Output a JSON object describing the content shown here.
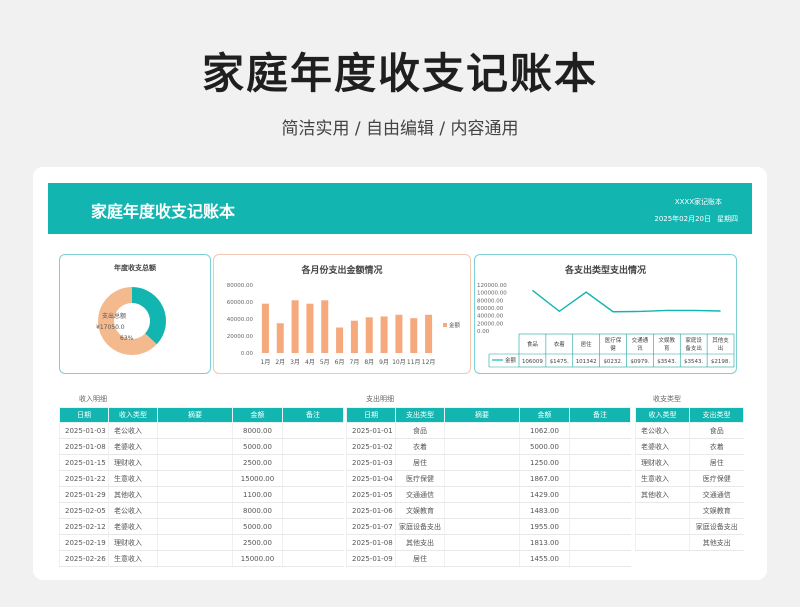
{
  "hero": {
    "title": "家庭年度收支记账本",
    "subtitle": "简洁实用 / 自由编辑 / 内容通用"
  },
  "banner": {
    "title": "家庭年度收支记账本",
    "brand": "XXXX家记账本",
    "date": "2025年02月20日",
    "weekday": "星期四"
  },
  "colors": {
    "accent": "#13b5b0",
    "bar": "#f5a97d",
    "ring_light": "#f5b98e"
  },
  "panels": {
    "donut": {
      "title": "年度收支总额",
      "label_expense": "支出总额",
      "label_value": "¥17050.0",
      "label_pct": "63%"
    },
    "bar": {
      "title": "各月份支出金额情况",
      "legend": "金额"
    },
    "line": {
      "title": "各支出类型支出情况",
      "legend": "金额"
    }
  },
  "chart_data": [
    {
      "type": "pie",
      "title": "年度收支总额",
      "slices": [
        {
          "label": "支出总额",
          "value": 17050.0,
          "percent": 63
        },
        {
          "label": "",
          "value": 10013.5,
          "percent": 37
        }
      ]
    },
    {
      "type": "bar",
      "title": "各月份支出金额情况",
      "categories": [
        "1月",
        "2月",
        "3月",
        "4月",
        "5月",
        "6月",
        "7月",
        "8月",
        "9月",
        "10月",
        "11月",
        "12月"
      ],
      "series": [
        {
          "name": "金额",
          "values": [
            58000,
            35000,
            62000,
            58000,
            62000,
            30000,
            38000,
            42000,
            43000,
            45000,
            41000,
            45000
          ]
        }
      ],
      "y_ticks": [
        "0.00",
        "20000.00",
        "40000.00",
        "60000.00",
        "80000.00"
      ],
      "ylim": [
        0,
        80000
      ]
    },
    {
      "type": "line",
      "title": "各支出类型支出情况",
      "categories": [
        "食品",
        "衣着",
        "居住",
        "医疗保健",
        "交通通讯",
        "文娱教育",
        "家庭设备支出",
        "其他支出"
      ],
      "category_lines": [
        [
          "食品"
        ],
        [
          "衣着"
        ],
        [
          "居住"
        ],
        [
          "医疗保",
          "健"
        ],
        [
          "交通通",
          "讯"
        ],
        [
          "文娱教",
          "育"
        ],
        [
          "家庭设",
          "备支出"
        ],
        [
          "其他支",
          "出"
        ]
      ],
      "series": [
        {
          "name": "金额",
          "values": [
            106009,
            51475,
            101342,
            50232,
            50979,
            53543,
            53543,
            52198
          ]
        }
      ],
      "table_values": [
        "106009",
        "$1475.",
        "101342",
        "$0232.",
        "$0979.",
        "$3543.",
        "$3543.",
        "$2198."
      ],
      "y_ticks": [
        "0.00",
        "20000.00",
        "40000.00",
        "60000.00",
        "80000.00",
        "100000.00",
        "120000.00"
      ],
      "ylim": [
        0,
        120000
      ]
    }
  ],
  "income": {
    "label": "收入明细",
    "headers": [
      "日期",
      "收入类型",
      "摘要",
      "金额",
      "备注"
    ],
    "rows": [
      [
        "2025-01-03",
        "老公收入",
        "",
        "8000.00",
        ""
      ],
      [
        "2025-01-08",
        "老婆收入",
        "",
        "5000.00",
        ""
      ],
      [
        "2025-01-15",
        "理财收入",
        "",
        "2500.00",
        ""
      ],
      [
        "2025-01-22",
        "生意收入",
        "",
        "15000.00",
        ""
      ],
      [
        "2025-01-29",
        "其他收入",
        "",
        "1100.00",
        ""
      ],
      [
        "2025-02-05",
        "老公收入",
        "",
        "8000.00",
        ""
      ],
      [
        "2025-02-12",
        "老婆收入",
        "",
        "5000.00",
        ""
      ],
      [
        "2025-02-19",
        "理财收入",
        "",
        "2500.00",
        ""
      ],
      [
        "2025-02-26",
        "生意收入",
        "",
        "15000.00",
        ""
      ]
    ]
  },
  "expense": {
    "label": "支出明细",
    "headers": [
      "日期",
      "支出类型",
      "摘要",
      "金额",
      "备注"
    ],
    "rows": [
      [
        "2025-01-01",
        "食品",
        "",
        "1062.00",
        ""
      ],
      [
        "2025-01-02",
        "衣着",
        "",
        "5000.00",
        ""
      ],
      [
        "2025-01-03",
        "居住",
        "",
        "1250.00",
        ""
      ],
      [
        "2025-01-04",
        "医疗保健",
        "",
        "1867.00",
        ""
      ],
      [
        "2025-01-05",
        "交通通信",
        "",
        "1429.00",
        ""
      ],
      [
        "2025-01-06",
        "文娱教育",
        "",
        "1483.00",
        ""
      ],
      [
        "2025-01-07",
        "家庭设备支出",
        "",
        "1955.00",
        ""
      ],
      [
        "2025-01-08",
        "其他支出",
        "",
        "1813.00",
        ""
      ],
      [
        "2025-01-09",
        "居住",
        "",
        "1455.00",
        ""
      ]
    ]
  },
  "types": {
    "label": "收支类型",
    "headers": [
      "收入类型",
      "支出类型"
    ],
    "rows": [
      [
        "老公收入",
        "食品"
      ],
      [
        "老婆收入",
        "衣着"
      ],
      [
        "理财收入",
        "居住"
      ],
      [
        "生意收入",
        "医疗保健"
      ],
      [
        "其他收入",
        "交通通信"
      ],
      [
        "",
        "文娱教育"
      ],
      [
        "",
        "家庭设备支出"
      ],
      [
        "",
        "其他支出"
      ]
    ]
  }
}
